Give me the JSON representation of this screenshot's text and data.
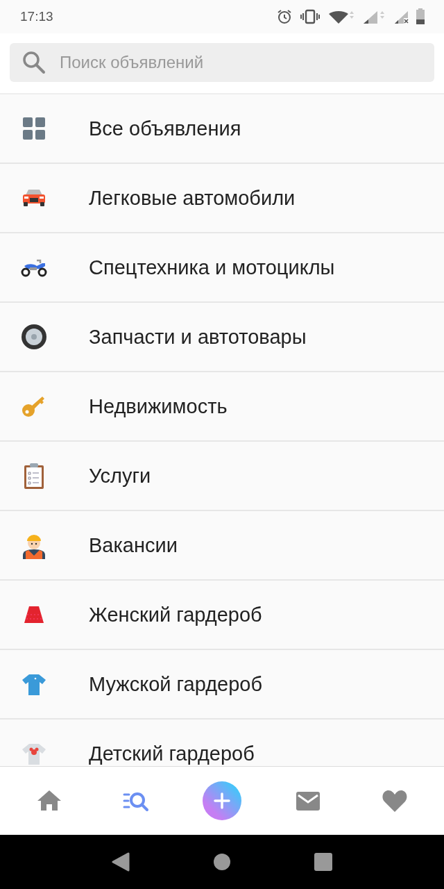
{
  "status_bar": {
    "time": "17:13"
  },
  "search": {
    "placeholder": "Поиск объявлений"
  },
  "categories": [
    {
      "label": "Все объявления"
    },
    {
      "label": "Легковые автомобили"
    },
    {
      "label": "Спецтехника и мотоциклы"
    },
    {
      "label": "Запчасти и автотовары"
    },
    {
      "label": "Недвижимость"
    },
    {
      "label": "Услуги"
    },
    {
      "label": "Вакансии"
    },
    {
      "label": "Женский гардероб"
    },
    {
      "label": "Мужской гардероб"
    },
    {
      "label": "Детский гардероб"
    }
  ],
  "bottom_nav": [
    {
      "kind": "tab",
      "selected": false
    },
    {
      "kind": "tab",
      "selected": true
    },
    {
      "kind": "action",
      "selected": false
    },
    {
      "kind": "tab",
      "selected": false
    },
    {
      "kind": "tab",
      "selected": false
    }
  ]
}
